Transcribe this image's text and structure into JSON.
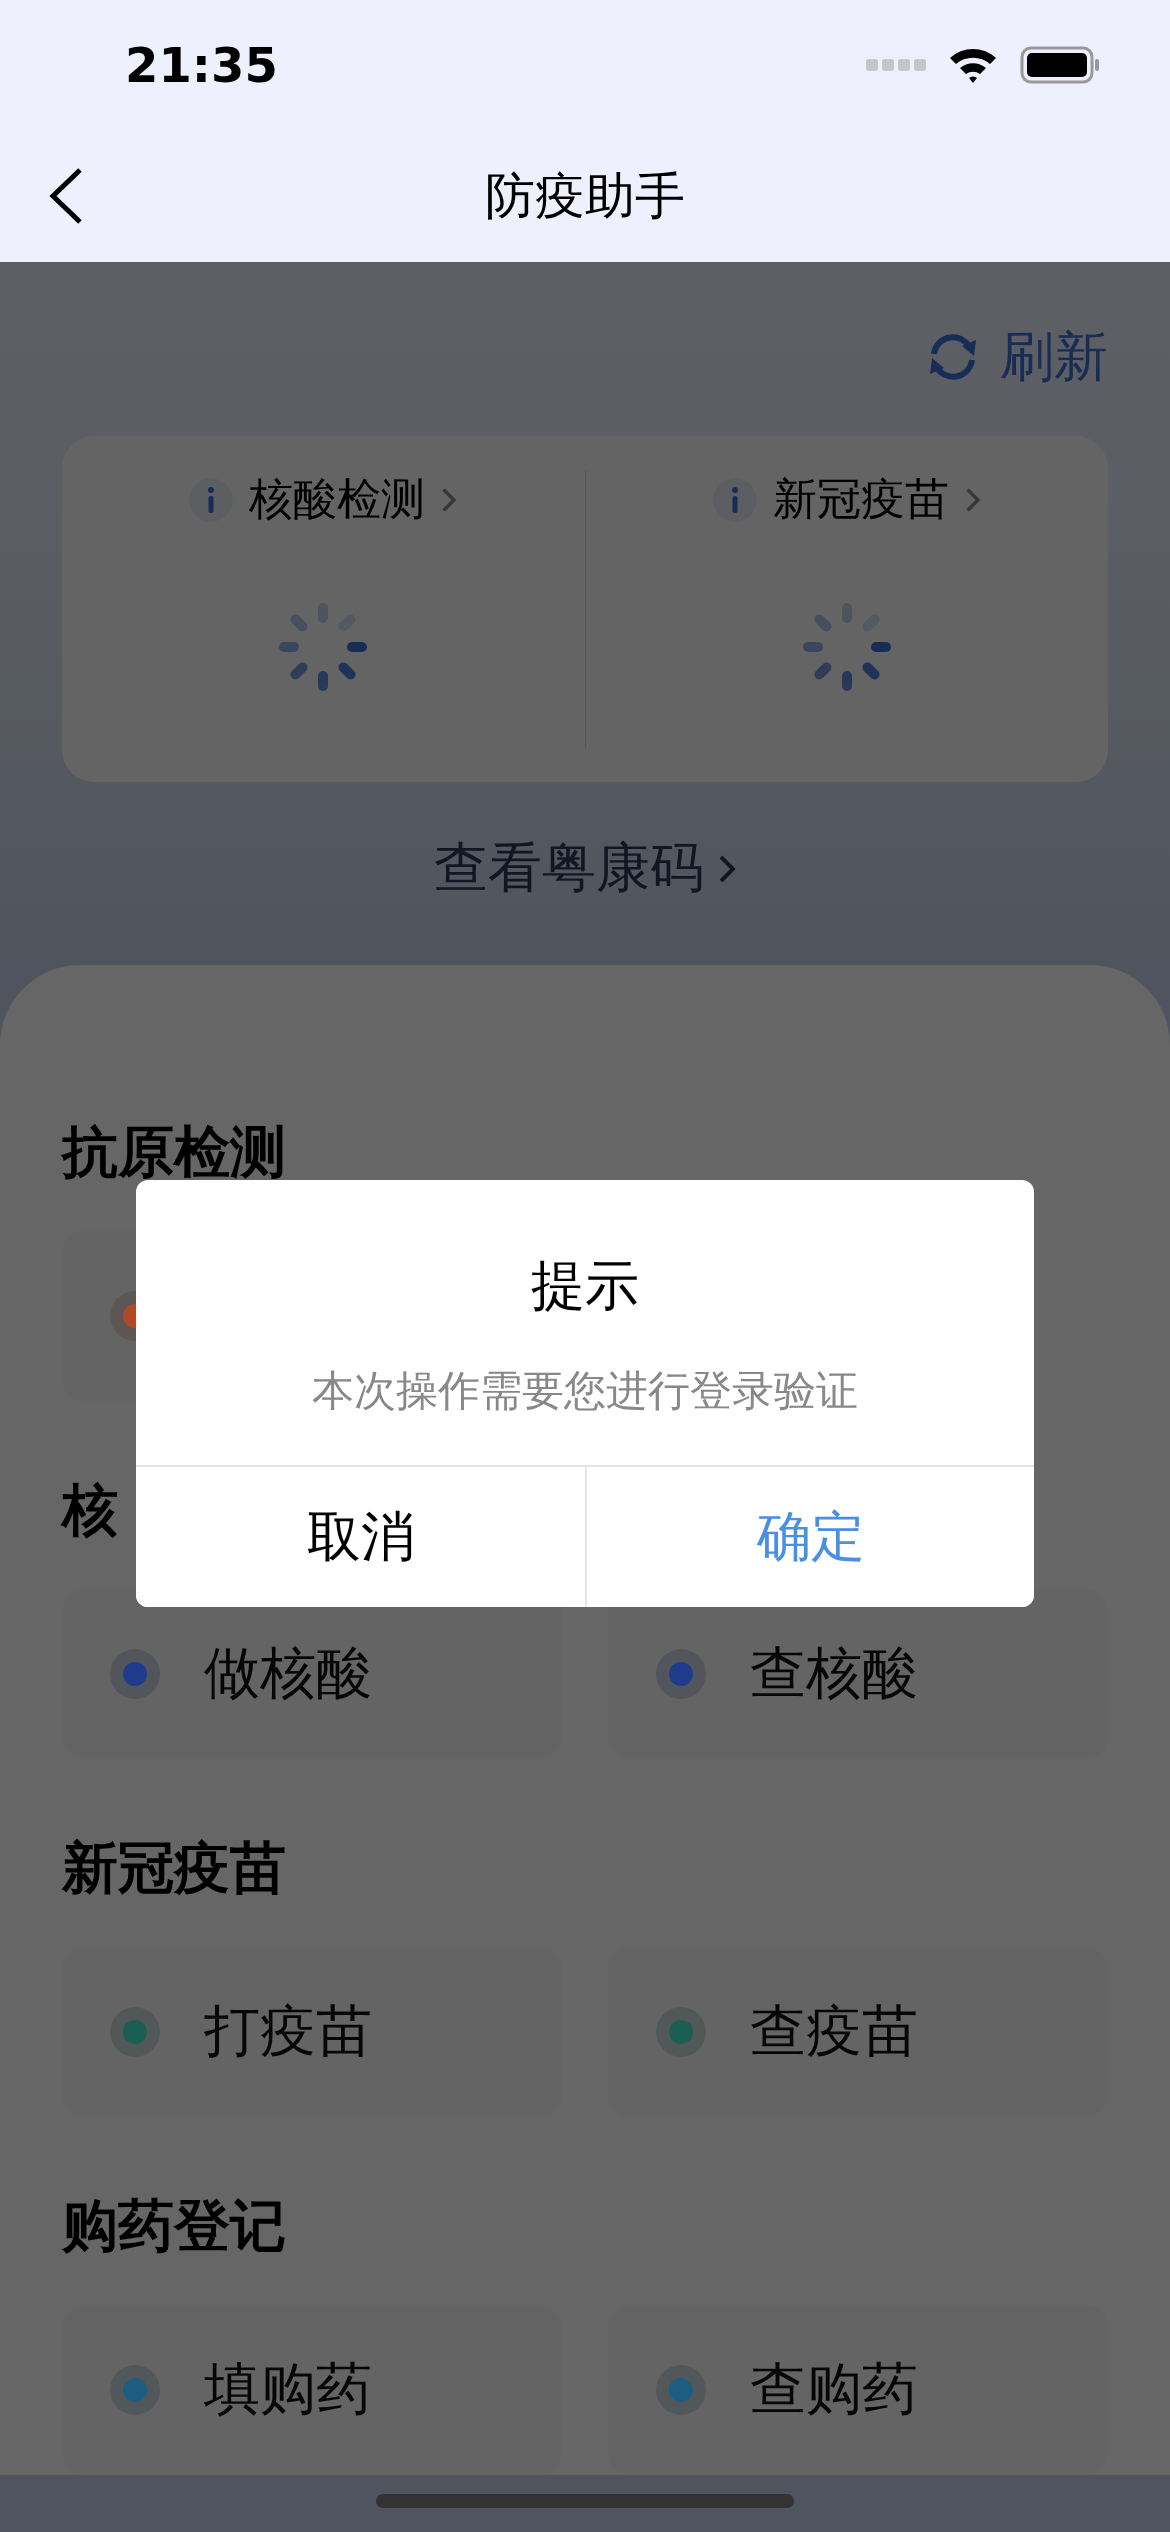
{
  "status_bar": {
    "time": "21:35"
  },
  "nav": {
    "title": "防疫助手"
  },
  "refresh": {
    "label": "刷新"
  },
  "summary": [
    {
      "title": "核酸检测"
    },
    {
      "title": "新冠疫苗"
    }
  ],
  "health_code_link": {
    "label": "查看粤康码"
  },
  "sections": [
    {
      "title": "抗原检测",
      "items": [
        {
          "color": "#b04a26"
        }
      ]
    },
    {
      "title": "核",
      "items": [
        {
          "label": "做核酸",
          "color": "#1f3c8c"
        },
        {
          "label": "查核酸",
          "color": "#1f3c8c"
        }
      ]
    },
    {
      "title": "新冠疫苗",
      "items": [
        {
          "label": "打疫苗",
          "color": "#1b5e54"
        },
        {
          "label": "查疫苗",
          "color": "#1b5e54"
        }
      ]
    },
    {
      "title": "购药登记",
      "items": [
        {
          "label": "填购药",
          "color": "#1f5c82"
        },
        {
          "label": "查购药",
          "color": "#1f5c82"
        }
      ]
    }
  ],
  "dialog": {
    "title": "提示",
    "message": "本次操作需要您进行登录验证",
    "buttons": [
      {
        "label": "取消",
        "kind": "cancel"
      },
      {
        "label": "确定",
        "kind": "confirm"
      }
    ]
  }
}
